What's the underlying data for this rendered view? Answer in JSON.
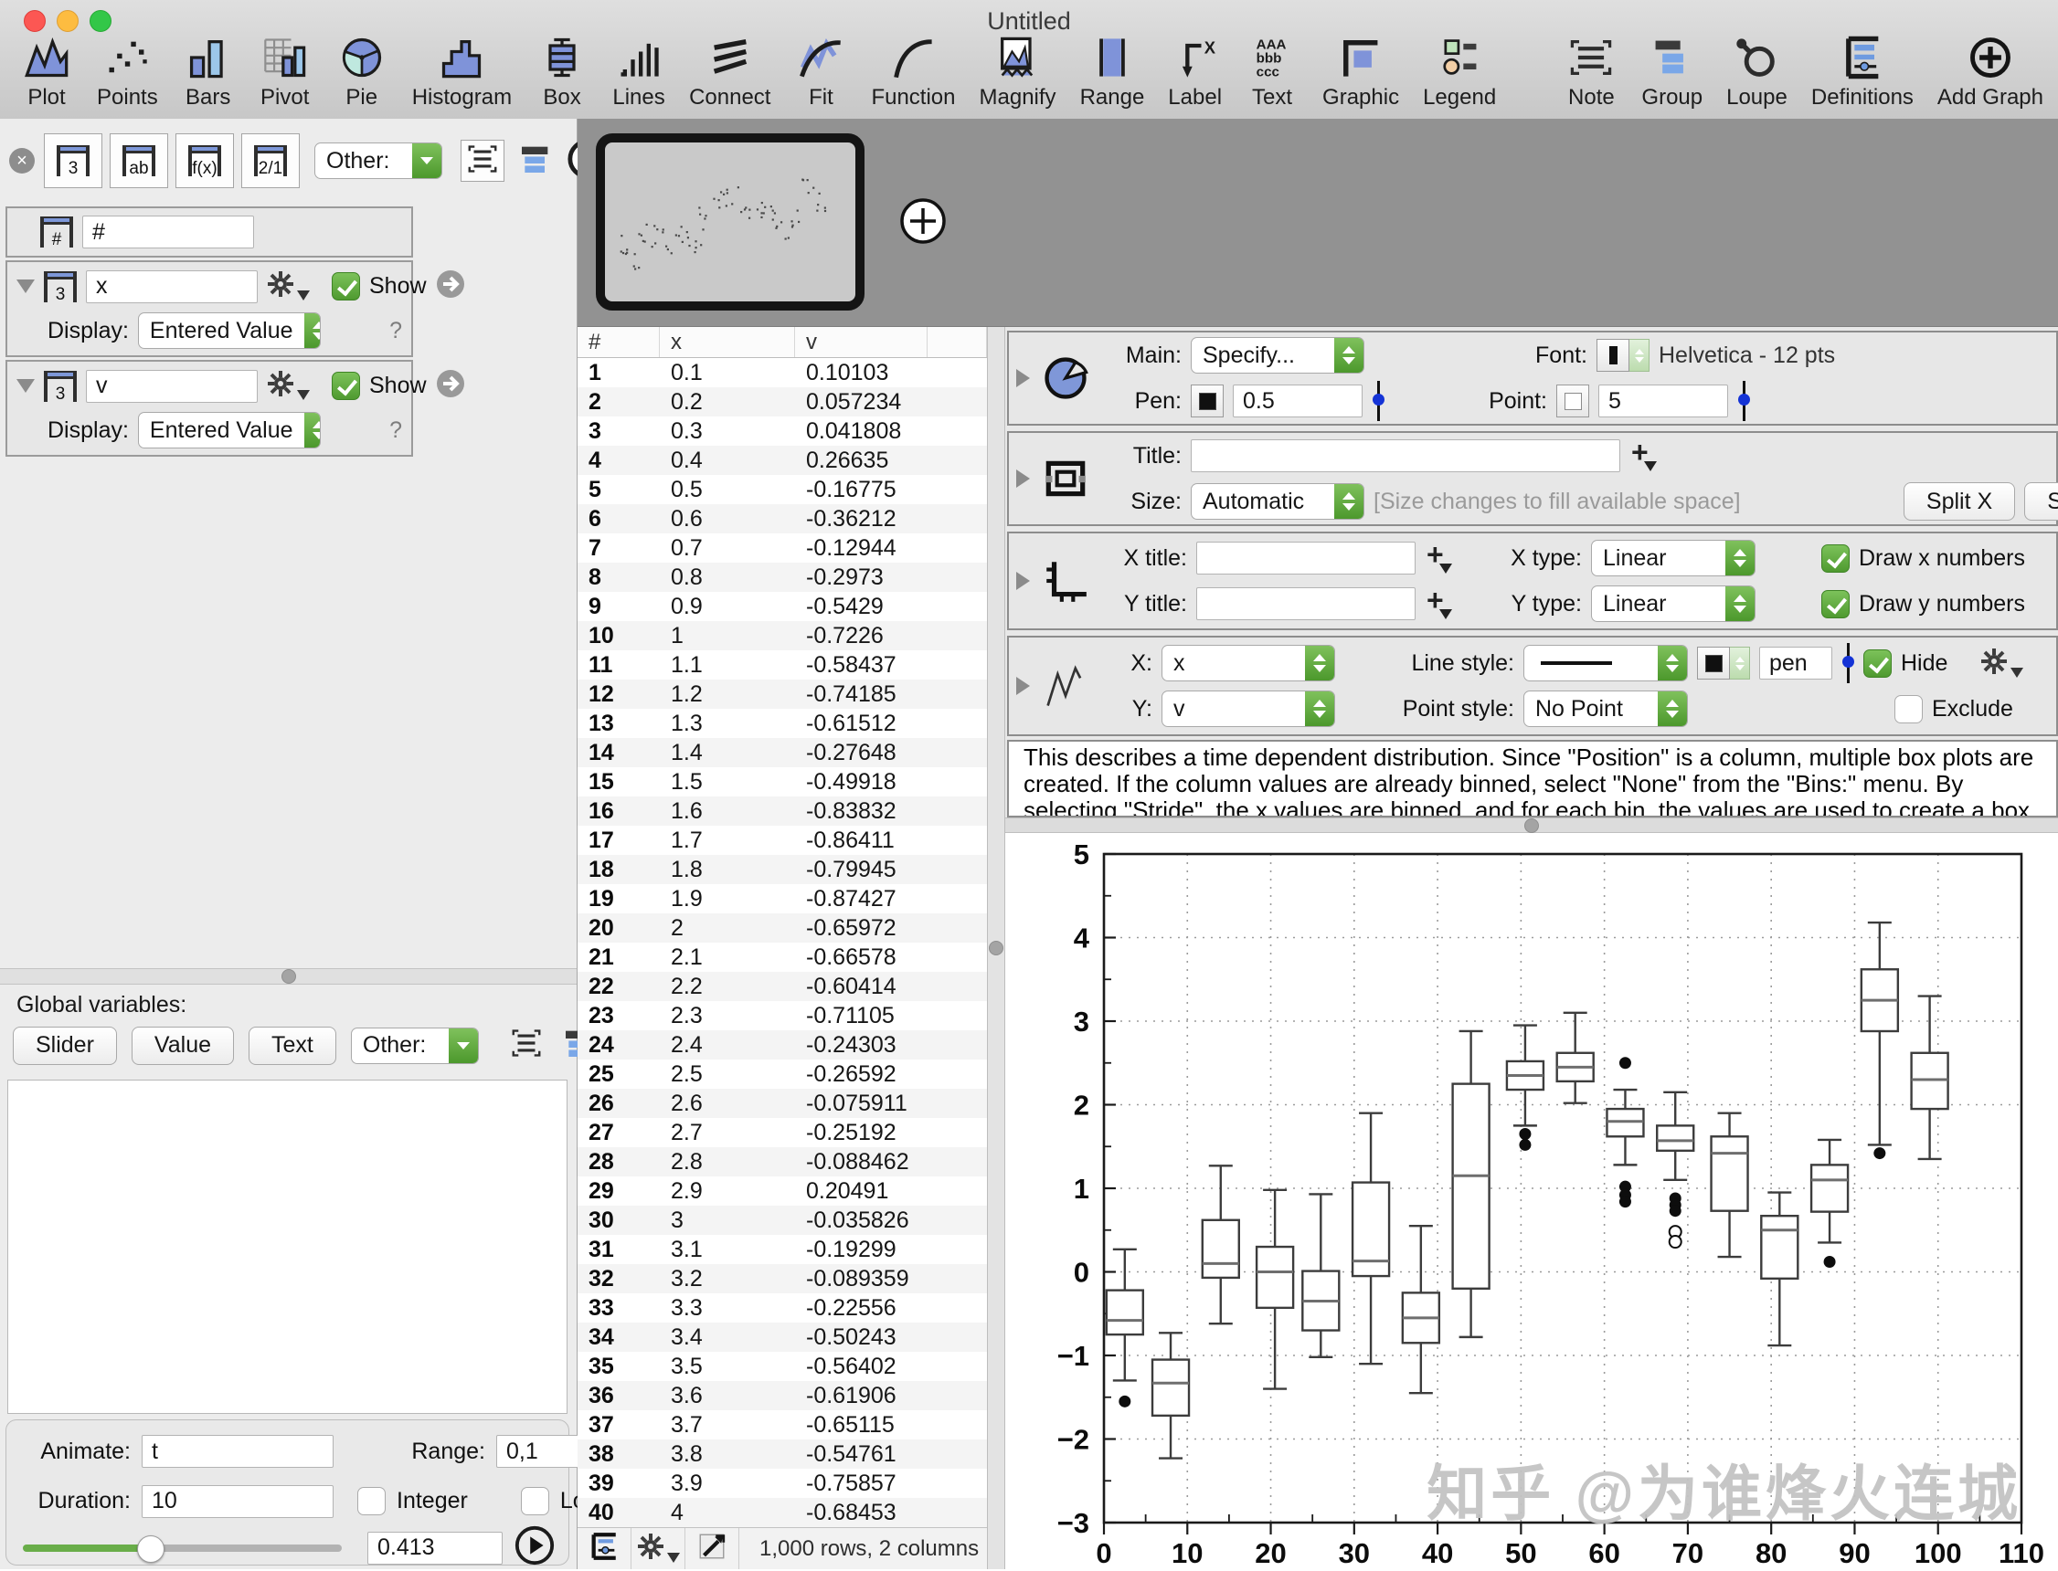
{
  "window": {
    "title": "Untitled"
  },
  "toolbar": {
    "items": [
      {
        "label": "Plot",
        "icon": "plot"
      },
      {
        "label": "Points",
        "icon": "points"
      },
      {
        "label": "Bars",
        "icon": "bars"
      },
      {
        "label": "Pivot",
        "icon": "pivot"
      },
      {
        "label": "Pie",
        "icon": "pie"
      },
      {
        "label": "Histogram",
        "icon": "histogram"
      },
      {
        "label": "Box",
        "icon": "box"
      },
      {
        "label": "Lines",
        "icon": "lines"
      },
      {
        "label": "Connect",
        "icon": "connect"
      },
      {
        "label": "Fit",
        "icon": "fit"
      },
      {
        "label": "Function",
        "icon": "function"
      },
      {
        "label": "Magnify",
        "icon": "magnify"
      },
      {
        "label": "Range",
        "icon": "range"
      },
      {
        "label": "Label",
        "icon": "label"
      },
      {
        "label": "Text",
        "icon": "text"
      },
      {
        "label": "Graphic",
        "icon": "graphic"
      },
      {
        "label": "Legend",
        "icon": "legend"
      }
    ],
    "right_items": [
      {
        "label": "Note",
        "icon": "note"
      },
      {
        "label": "Group",
        "icon": "group"
      },
      {
        "label": "Loupe",
        "icon": "loupe"
      },
      {
        "label": "Definitions",
        "icon": "definitions"
      },
      {
        "label": "Add Graph",
        "icon": "addgraph"
      }
    ]
  },
  "icons": {
    "close": "×",
    "help": "?"
  },
  "left_panel": {
    "column_type_buttons": [
      "3",
      "ab",
      "f(x)",
      "2/1"
    ],
    "other_label": "Other:",
    "cards": {
      "number": {
        "icon_label": "#",
        "name": "#"
      },
      "x": {
        "icon_label": "3",
        "name": "x",
        "show_label": "Show",
        "display_label": "Display:",
        "display_value": "Entered Value",
        "help": "?"
      },
      "v": {
        "icon_label": "3",
        "name": "v",
        "show_label": "Show",
        "display_label": "Display:",
        "display_value": "Entered Value",
        "help": "?"
      }
    },
    "global": {
      "label": "Global variables:",
      "buttons": [
        "Slider",
        "Value",
        "Text"
      ],
      "other_label": "Other:"
    },
    "animate": {
      "animate_label": "Animate:",
      "animate_value": "t",
      "range_label": "Range:",
      "range_value": "0,1",
      "duration_label": "Duration:",
      "duration_value": "10",
      "integer_label": "Integer",
      "loop_label": "Loop",
      "slider_value": "0.413",
      "slider_fraction": 0.4
    }
  },
  "table": {
    "headers": [
      "#",
      "x",
      "v",
      ""
    ],
    "status": "1,000 rows, 2 columns",
    "rows": [
      [
        "1",
        "0.1",
        "0.10103"
      ],
      [
        "2",
        "0.2",
        "0.057234"
      ],
      [
        "3",
        "0.3",
        "0.041808"
      ],
      [
        "4",
        "0.4",
        "0.26635"
      ],
      [
        "5",
        "0.5",
        "-0.16775"
      ],
      [
        "6",
        "0.6",
        "-0.36212"
      ],
      [
        "7",
        "0.7",
        "-0.12944"
      ],
      [
        "8",
        "0.8",
        "-0.2973"
      ],
      [
        "9",
        "0.9",
        "-0.5429"
      ],
      [
        "10",
        "1",
        "-0.7226"
      ],
      [
        "11",
        "1.1",
        "-0.58437"
      ],
      [
        "12",
        "1.2",
        "-0.74185"
      ],
      [
        "13",
        "1.3",
        "-0.61512"
      ],
      [
        "14",
        "1.4",
        "-0.27648"
      ],
      [
        "15",
        "1.5",
        "-0.49918"
      ],
      [
        "16",
        "1.6",
        "-0.83832"
      ],
      [
        "17",
        "1.7",
        "-0.86411"
      ],
      [
        "18",
        "1.8",
        "-0.79945"
      ],
      [
        "19",
        "1.9",
        "-0.87427"
      ],
      [
        "20",
        "2",
        "-0.65972"
      ],
      [
        "21",
        "2.1",
        "-0.66578"
      ],
      [
        "22",
        "2.2",
        "-0.60414"
      ],
      [
        "23",
        "2.3",
        "-0.71105"
      ],
      [
        "24",
        "2.4",
        "-0.24303"
      ],
      [
        "25",
        "2.5",
        "-0.26592"
      ],
      [
        "26",
        "2.6",
        "-0.075911"
      ],
      [
        "27",
        "2.7",
        "-0.25192"
      ],
      [
        "28",
        "2.8",
        "-0.088462"
      ],
      [
        "29",
        "2.9",
        "0.20491"
      ],
      [
        "30",
        "3",
        "-0.035826"
      ],
      [
        "31",
        "3.1",
        "-0.19299"
      ],
      [
        "32",
        "3.2",
        "-0.089359"
      ],
      [
        "33",
        "3.3",
        "-0.22556"
      ],
      [
        "34",
        "3.4",
        "-0.50243"
      ],
      [
        "35",
        "3.5",
        "-0.56402"
      ],
      [
        "36",
        "3.6",
        "-0.61906"
      ],
      [
        "37",
        "3.7",
        "-0.65115"
      ],
      [
        "38",
        "3.8",
        "-0.54761"
      ],
      [
        "39",
        "3.9",
        "-0.75857"
      ],
      [
        "40",
        "4",
        "-0.68453"
      ]
    ]
  },
  "inspector": {
    "main_label": "Main:",
    "main_value": "Specify...",
    "font_label": "Font:",
    "font_value": "Helvetica - 12 pts",
    "pen_label": "Pen:",
    "pen_value": "0.5",
    "point_label": "Point:",
    "point_value": "5",
    "title_label": "Title:",
    "size_label": "Size:",
    "size_value": "Automatic",
    "size_hint": "[Size changes to fill available space]",
    "split_x": "Split X",
    "split_y": "Split Y",
    "x_title_label": "X title:",
    "y_title_label": "Y title:",
    "x_type_label": "X type:",
    "y_type_label": "Y type:",
    "x_type_value": "Linear",
    "y_type_value": "Linear",
    "draw_x_label": "Draw x numbers",
    "draw_y_label": "Draw y numbers",
    "x_label": "X:",
    "x_value": "x",
    "y_label": "Y:",
    "y_value": "v",
    "line_style_label": "Line style:",
    "pen_name": "pen",
    "hide_label": "Hide",
    "exclude_label": "Exclude",
    "point_style_label": "Point style:",
    "point_style_value": "No Point",
    "description": "This describes a time dependent distribution.  Since \"Position\" is a column, multiple box plots are created.  If the column values are already binned, select \"None\" from the \"Bins:\" menu.  By selecting \"Stride\", the x values are binned, and for each bin, the values are used to create a box plot."
  },
  "chart_data": {
    "type": "boxplot",
    "title": "",
    "xlabel": "",
    "ylabel": "",
    "xlim": [
      0,
      110
    ],
    "ylim": [
      -3,
      5
    ],
    "x_ticks": [
      0,
      10,
      20,
      30,
      40,
      50,
      60,
      70,
      80,
      90,
      100,
      110
    ],
    "y_ticks": [
      -3,
      -2,
      -1,
      0,
      1,
      2,
      3,
      4,
      5
    ],
    "grid": "dotted",
    "legend": "none",
    "watermark": "知乎 @为谁烽火连城",
    "boxes": [
      {
        "x": 2.5,
        "lo": -1.3,
        "q1": -0.75,
        "median": -0.58,
        "q3": -0.22,
        "hi": 0.27,
        "outliers": [
          -1.55
        ],
        "open_outliers": []
      },
      {
        "x": 8,
        "lo": -2.23,
        "q1": -1.72,
        "median": -1.33,
        "q3": -1.05,
        "hi": -0.73,
        "outliers": [],
        "open_outliers": []
      },
      {
        "x": 14,
        "lo": -0.62,
        "q1": -0.07,
        "median": 0.1,
        "q3": 0.62,
        "hi": 1.27,
        "outliers": [],
        "open_outliers": []
      },
      {
        "x": 20.5,
        "lo": -1.4,
        "q1": -0.43,
        "median": 0.0,
        "q3": 0.3,
        "hi": 0.98,
        "outliers": [],
        "open_outliers": []
      },
      {
        "x": 26,
        "lo": -1.02,
        "q1": -0.7,
        "median": -0.35,
        "q3": 0.01,
        "hi": 0.93,
        "outliers": [],
        "open_outliers": []
      },
      {
        "x": 32,
        "lo": -1.1,
        "q1": -0.05,
        "median": 0.13,
        "q3": 1.07,
        "hi": 1.9,
        "outliers": [],
        "open_outliers": []
      },
      {
        "x": 38,
        "lo": -1.45,
        "q1": -0.85,
        "median": -0.55,
        "q3": -0.25,
        "hi": 0.55,
        "outliers": [],
        "open_outliers": []
      },
      {
        "x": 44,
        "lo": -0.78,
        "q1": -0.2,
        "median": 1.15,
        "q3": 2.25,
        "hi": 2.88,
        "outliers": [],
        "open_outliers": []
      },
      {
        "x": 50.5,
        "lo": 1.75,
        "q1": 2.18,
        "median": 2.35,
        "q3": 2.52,
        "hi": 2.95,
        "outliers": [
          1.65,
          1.52
        ],
        "open_outliers": []
      },
      {
        "x": 56.5,
        "lo": 2.02,
        "q1": 2.28,
        "median": 2.45,
        "q3": 2.62,
        "hi": 3.1,
        "outliers": [],
        "open_outliers": []
      },
      {
        "x": 62.5,
        "lo": 1.28,
        "q1": 1.62,
        "median": 1.8,
        "q3": 1.95,
        "hi": 2.18,
        "outliers": [
          2.5,
          1.02,
          0.92,
          0.84
        ],
        "open_outliers": []
      },
      {
        "x": 68.5,
        "lo": 1.1,
        "q1": 1.45,
        "median": 1.57,
        "q3": 1.75,
        "hi": 2.15,
        "outliers": [
          0.88,
          0.8,
          0.73
        ],
        "open_outliers": [
          0.48,
          0.36
        ]
      },
      {
        "x": 75,
        "lo": 0.18,
        "q1": 0.73,
        "median": 1.42,
        "q3": 1.62,
        "hi": 1.9,
        "outliers": [],
        "open_outliers": []
      },
      {
        "x": 81,
        "lo": -0.88,
        "q1": -0.08,
        "median": 0.5,
        "q3": 0.67,
        "hi": 0.95,
        "outliers": [],
        "open_outliers": []
      },
      {
        "x": 87,
        "lo": 0.35,
        "q1": 0.72,
        "median": 1.1,
        "q3": 1.28,
        "hi": 1.58,
        "outliers": [
          0.12
        ],
        "open_outliers": []
      },
      {
        "x": 93,
        "lo": 1.52,
        "q1": 2.88,
        "median": 3.25,
        "q3": 3.62,
        "hi": 4.18,
        "outliers": [
          1.42
        ],
        "open_outliers": []
      },
      {
        "x": 99,
        "lo": 1.35,
        "q1": 1.95,
        "median": 2.3,
        "q3": 2.62,
        "hi": 3.3,
        "outliers": [],
        "open_outliers": []
      }
    ]
  }
}
